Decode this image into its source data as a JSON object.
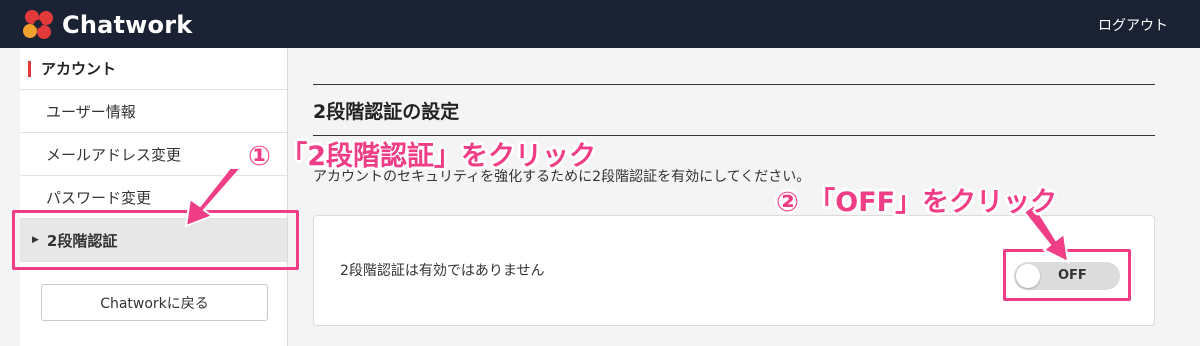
{
  "header": {
    "brand": "Chatwork",
    "logout_label": "ログアウト",
    "logo_colors": [
      "#e2393b",
      "#f0a02d",
      "#b7c43c"
    ]
  },
  "sidebar": {
    "section_title": "アカウント",
    "items": [
      {
        "label": "ユーザー情報",
        "active": false
      },
      {
        "label": "メールアドレス変更",
        "active": false
      },
      {
        "label": "パスワード変更",
        "active": false
      },
      {
        "label": "2段階認証",
        "active": true
      }
    ],
    "back_button": "Chatworkに戻る"
  },
  "main": {
    "title": "2段階認証の設定",
    "description": "アカウントのセキュリティを強化するために2段階認証を有効にしてください。",
    "status_text": "2段階認証は有効ではありません",
    "toggle_label": "OFF",
    "toggle_on": false
  },
  "annotations": {
    "step1": "① 「2段階認証」をクリック",
    "step2": "② 「OFF」をクリック",
    "color": "#ef3d86"
  }
}
